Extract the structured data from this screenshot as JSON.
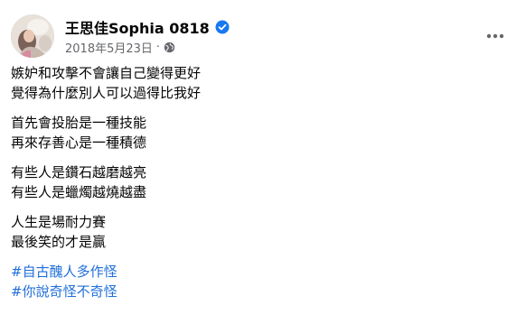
{
  "post": {
    "author": {
      "name": "王思佳Sophia 0818",
      "verified": true,
      "verified_icon": "verified-badge-icon"
    },
    "meta": {
      "timestamp": "2018年5月23日",
      "separator": "·",
      "audience_icon": "globe-icon"
    },
    "more_icon": "more-options-icon",
    "paragraphs": [
      [
        "嫉妒和攻擊不會讓自己變得更好",
        "覺得為什麼別人可以過得比我好"
      ],
      [
        "首先會投胎是一種技能",
        "再來存善心是一種積德"
      ],
      [
        "有些人是鑽石越磨越亮",
        "有些人是蠟燭越燒越盡"
      ],
      [
        "人生是場耐力賽",
        "最後笑的才是贏"
      ]
    ],
    "hashtags": [
      "#自古醜人多作怪",
      "#你說奇怪不奇怪"
    ]
  },
  "colors": {
    "text": "#050505",
    "meta": "#65676b",
    "link": "#216fdb",
    "verified": "#1877f2"
  }
}
